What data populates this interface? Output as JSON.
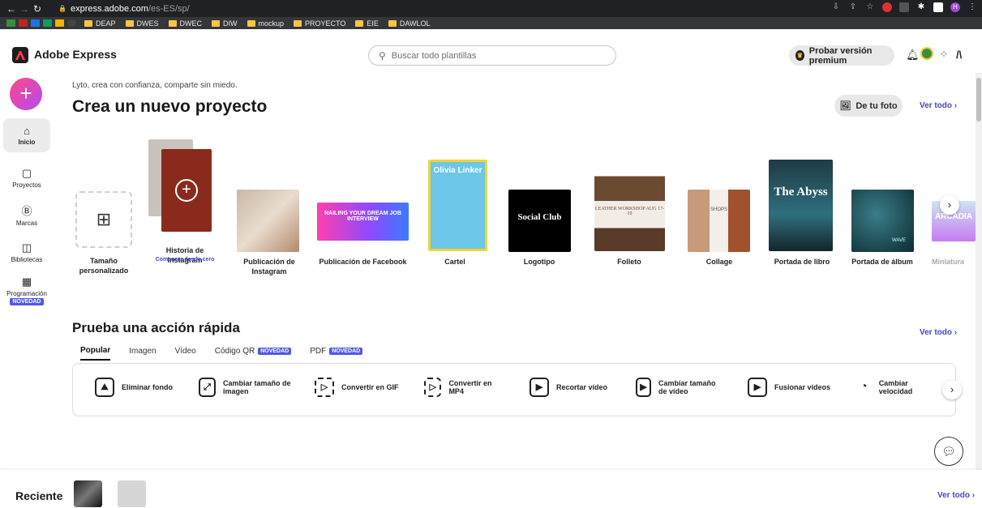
{
  "browser": {
    "url_host": "express.adobe.com",
    "url_path": "/es-ES/sp/",
    "bookmarks": [
      "DEAP",
      "DWES",
      "DWEC",
      "DIW",
      "mockup",
      "PROYECTO",
      "EIE",
      "DAWLOL"
    ]
  },
  "header": {
    "brand": "Adobe Express",
    "search_placeholder": "Buscar todo plantillas",
    "premium_label": "Probar versión premium"
  },
  "sidebar": {
    "create_label": "+",
    "items": [
      {
        "label": "Inicio",
        "icon": "home-icon"
      },
      {
        "label": "Proyectos",
        "icon": "folder-icon"
      },
      {
        "label": "Marcas",
        "icon": "brand-icon"
      },
      {
        "label": "Bibliotecas",
        "icon": "library-icon"
      },
      {
        "label": "Programación",
        "icon": "calendar-icon",
        "badge": "NOVEDAD"
      }
    ]
  },
  "hero": {
    "tagline": "Lyto, crea con confianza, comparte sin miedo.",
    "title": "Crea un nuevo proyecto",
    "from_photo": "De tu foto",
    "see_all": "Ver todo ›"
  },
  "templates": [
    {
      "label": "Tamaño personalizado"
    },
    {
      "label": "Historia de Instagram",
      "sub": "Comenzar desde cero"
    },
    {
      "label": "Publicación de Instagram"
    },
    {
      "label": "Publicación de Facebook",
      "thumb_text": "NAILING YOUR DREAM JOB INTERVIEW"
    },
    {
      "label": "Cartel",
      "thumb_text": "Olivia Linker"
    },
    {
      "label": "Logotipo",
      "thumb_text": "Social Club"
    },
    {
      "label": "Folleto",
      "thumb_text": "LEATHER WORKSHOP AUG 17-19"
    },
    {
      "label": "Collage",
      "thumb_text": "SHOPS"
    },
    {
      "label": "Portada de libro",
      "thumb_text": "The Abyss"
    },
    {
      "label": "Portada de álbum",
      "thumb_text": "WAVE"
    },
    {
      "label": "Miniatura",
      "thumb_text": "ARCADIA"
    }
  ],
  "quick_actions": {
    "title": "Prueba una acción rápida",
    "see_all": "Ver todo ›",
    "tabs": [
      {
        "label": "Popular",
        "active": true
      },
      {
        "label": "Imagen"
      },
      {
        "label": "Vídeo"
      },
      {
        "label": "Código QR",
        "badge": "NOVEDAD"
      },
      {
        "label": "PDF",
        "badge": "NOVEDAD"
      }
    ],
    "actions": [
      {
        "label": "Eliminar fondo"
      },
      {
        "label": "Cambiar tamaño de imagen"
      },
      {
        "label": "Convertir en GIF"
      },
      {
        "label": "Convertir en MP4"
      },
      {
        "label": "Recortar vídeo"
      },
      {
        "label": "Cambiar tamaño de vídeo"
      },
      {
        "label": "Fusionar vídeos"
      },
      {
        "label": "Cambiar velocidad"
      }
    ]
  },
  "recent": {
    "title": "Reciente",
    "see_all": "Ver todo ›"
  },
  "colors": {
    "accent": "#5258e4",
    "link": "#4646c6"
  }
}
